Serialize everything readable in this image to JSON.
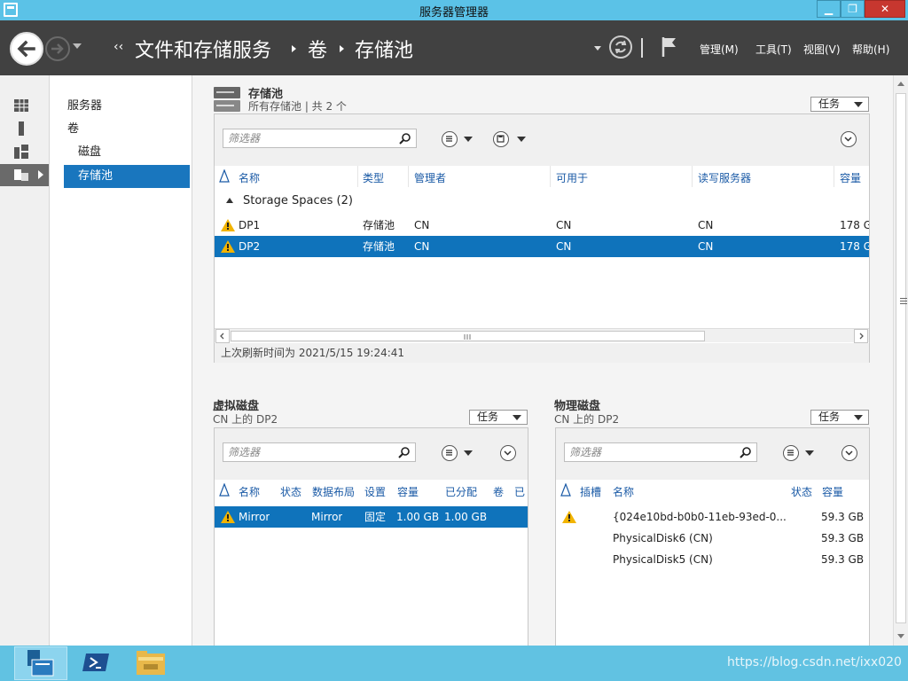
{
  "window": {
    "title": "服务器管理器"
  },
  "breadcrumb": {
    "lead": "‹‹",
    "items": [
      "文件和存储服务",
      "卷",
      "存储池"
    ]
  },
  "menu": {
    "manage": "管理(M)",
    "tools": "工具(T)",
    "view": "视图(V)",
    "help": "帮助(H)"
  },
  "tree": {
    "items": [
      "服务器",
      "卷",
      "磁盘",
      "存储池"
    ]
  },
  "storage_pools": {
    "title": "存储池",
    "subtitle": "所有存储池 | 共 2 个",
    "tasks_label": "任务",
    "filter_placeholder": "筛选器",
    "columns": [
      "名称",
      "类型",
      "管理者",
      "可用于",
      "读写服务器",
      "容量"
    ],
    "group": "Storage Spaces (2)",
    "rows": [
      {
        "name": "DP1",
        "type": "存储池",
        "managed_by": "CN",
        "available_to": "CN",
        "rw_server": "CN",
        "capacity": "178 G"
      },
      {
        "name": "DP2",
        "type": "存储池",
        "managed_by": "CN",
        "available_to": "CN",
        "rw_server": "CN",
        "capacity": "178 G"
      }
    ],
    "last_refresh": "上次刷新时间为 2021/5/15 19:24:41"
  },
  "virtual_disks": {
    "title": "虚拟磁盘",
    "subtitle": "CN 上的 DP2",
    "tasks_label": "任务",
    "filter_placeholder": "筛选器",
    "columns": [
      "名称",
      "状态",
      "数据布局",
      "设置",
      "容量",
      "已分配",
      "卷",
      "已"
    ],
    "rows": [
      {
        "name": "Mirror",
        "status": "",
        "layout": "Mirror",
        "provisioning": "固定",
        "capacity": "1.00 GB",
        "allocated": "1.00 GB"
      }
    ]
  },
  "physical_disks": {
    "title": "物理磁盘",
    "subtitle": "CN 上的 DP2",
    "tasks_label": "任务",
    "filter_placeholder": "筛选器",
    "columns": [
      "插槽",
      "名称",
      "状态",
      "容量"
    ],
    "rows": [
      {
        "name": "{024e10bd-b0b0-11eb-93ed-0...",
        "capacity": "59.3 GB",
        "warning": true
      },
      {
        "name": "PhysicalDisk6 (CN)",
        "capacity": "59.3 GB",
        "warning": false
      },
      {
        "name": "PhysicalDisk5 (CN)",
        "capacity": "59.3 GB",
        "warning": false
      }
    ]
  },
  "taskbar": {
    "tray_text": "https://blog.csdn.net/ixx020"
  }
}
